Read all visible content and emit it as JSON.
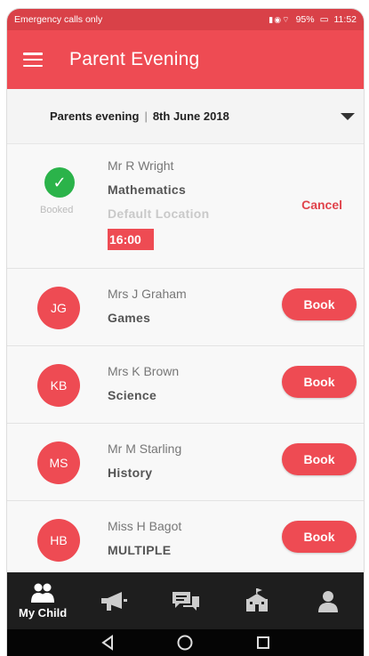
{
  "status_bar": {
    "carrier_text": "Emergency calls only",
    "battery": "95%",
    "time": "11:52"
  },
  "app_bar": {
    "title": "Parent Evening",
    "menu_icon": "hamburger-icon"
  },
  "event_selector": {
    "event_name": "Parents evening",
    "separator": "|",
    "date": "8th June 2018"
  },
  "appointments": [
    {
      "status": "booked",
      "status_label": "Booked",
      "teacher": "Mr R Wright",
      "subject": "Mathematics",
      "location": "Default Location",
      "time": "16:00",
      "action_label": "Cancel"
    },
    {
      "initials": "JG",
      "teacher": "Mrs J Graham",
      "subject": "Games",
      "action_label": "Book"
    },
    {
      "initials": "KB",
      "teacher": "Mrs K Brown",
      "subject": "Science",
      "action_label": "Book"
    },
    {
      "initials": "MS",
      "teacher": "Mr M Starling",
      "subject": "History",
      "action_label": "Book"
    },
    {
      "initials": "HB",
      "teacher": "Miss H Bagot",
      "subject": "MULTIPLE",
      "action_label": "Book"
    }
  ],
  "bottom_nav": {
    "items": [
      {
        "label": "My Child",
        "icon": "children-icon",
        "active": true
      },
      {
        "icon": "megaphone-icon"
      },
      {
        "icon": "chat-icon"
      },
      {
        "icon": "school-icon"
      },
      {
        "icon": "person-icon"
      }
    ]
  },
  "colors": {
    "primary": "#ee4b53",
    "status_bar": "#d94148",
    "booked_green": "#2bb34a",
    "nav_background": "#1e1e1e"
  }
}
